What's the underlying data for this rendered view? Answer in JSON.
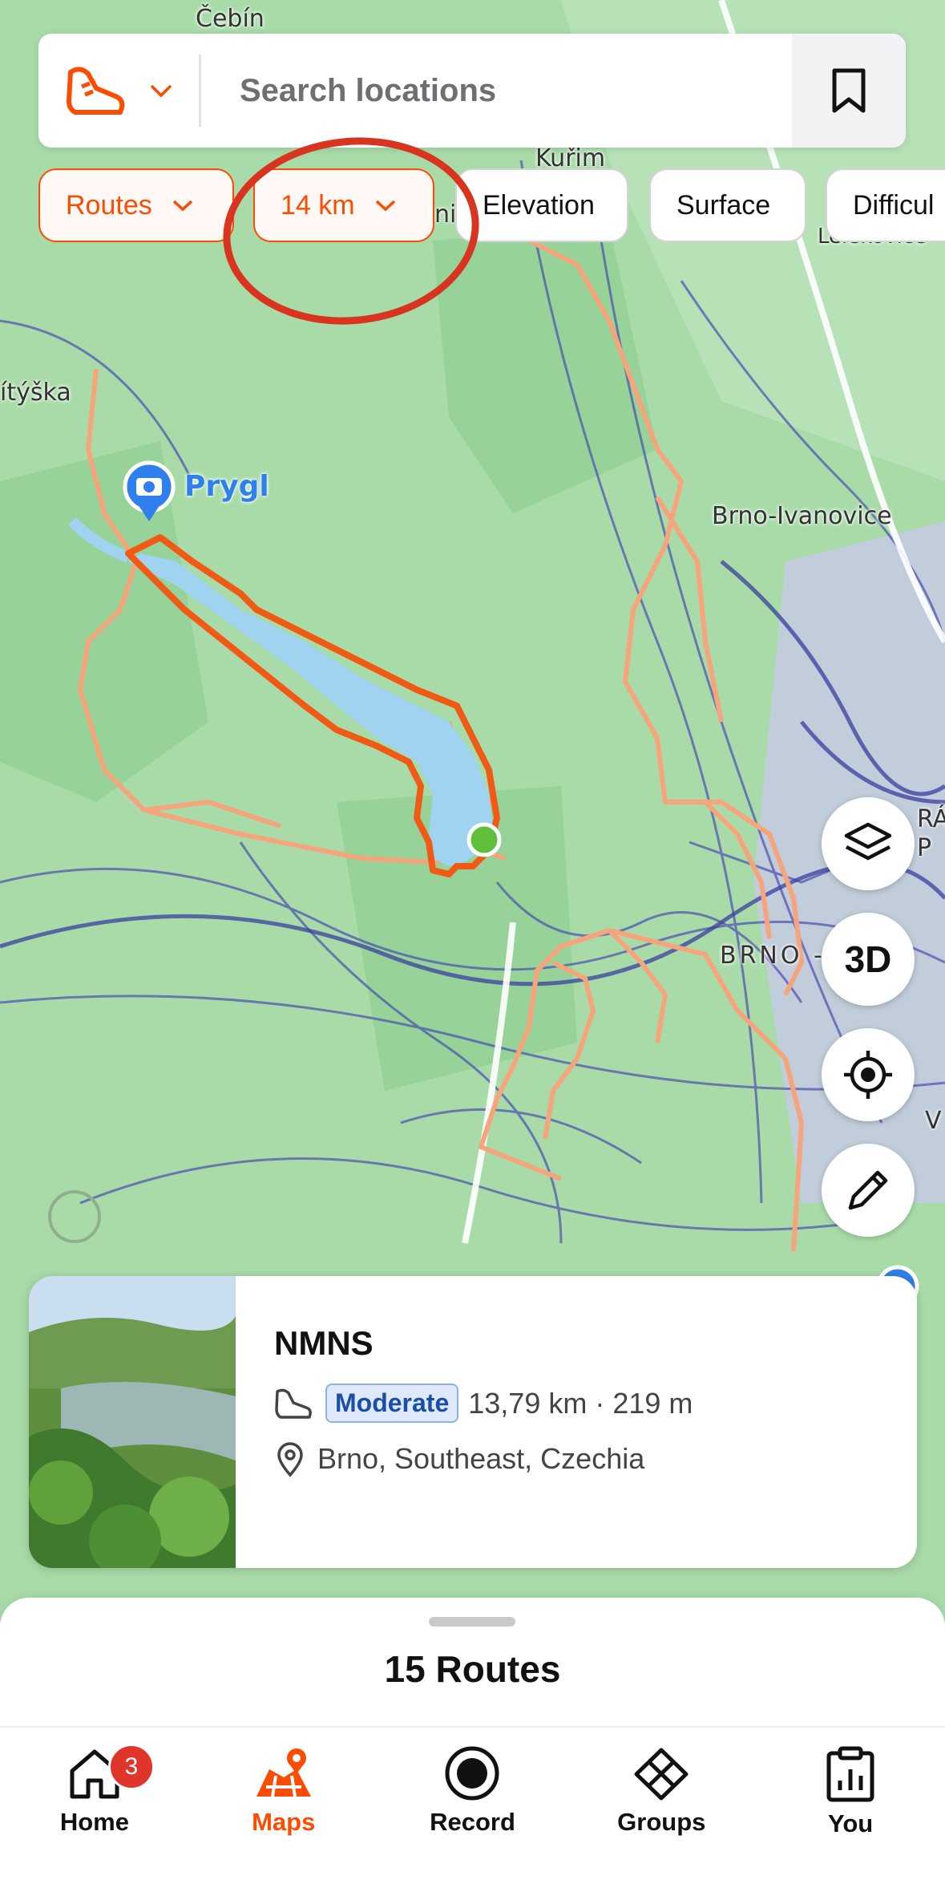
{
  "map": {
    "places": [
      {
        "name": "Čebín"
      },
      {
        "name": "Kuřim"
      },
      {
        "name": "ni"
      },
      {
        "name": "ítýška"
      },
      {
        "name": "Brno-Ivanovice"
      },
      {
        "name": "BRNO - VŘ"
      },
      {
        "name": "Lelekovice"
      },
      {
        "name": "RÁ"
      },
      {
        "name": "P"
      },
      {
        "name": "V"
      }
    ],
    "poi": {
      "label": "Prygl",
      "icon": "camera-icon"
    }
  },
  "search": {
    "placeholder": "Search locations",
    "sport_icon": "shoe-icon",
    "bookmark_icon": "bookmark-icon"
  },
  "filters": {
    "routes": "Routes",
    "distance": "14 km",
    "elevation": "Elevation",
    "surface": "Surface",
    "difficulty": "Difficul"
  },
  "fab": {
    "layers_icon": "layers-icon",
    "three_d": "3D",
    "locate_icon": "crosshair-icon",
    "draw_icon": "pencil-icon"
  },
  "route_card": {
    "title": "NMNS",
    "difficulty": "Moderate",
    "stats": "13,79 km · 219 m",
    "location": "Brno, Southeast, Czechia"
  },
  "sheet": {
    "title": "15 Routes"
  },
  "nav": {
    "home": "Home",
    "home_badge": "3",
    "maps": "Maps",
    "record": "Record",
    "groups": "Groups",
    "you": "You"
  },
  "colors": {
    "accent": "#fc4c02",
    "route_selected": "#f05a14",
    "route_other": "#f5a47c",
    "lake": "#9fd3f0"
  }
}
